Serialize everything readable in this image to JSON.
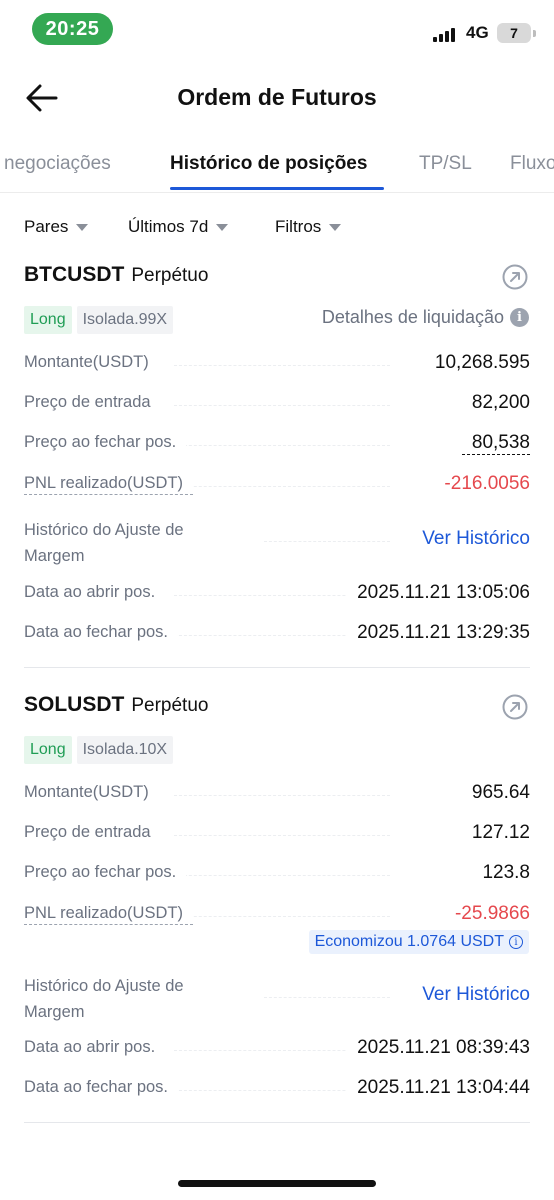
{
  "status_bar": {
    "time": "20:25",
    "network": "4G",
    "battery": "7"
  },
  "header": {
    "title": "Ordem de Futuros",
    "back_icon": "arrow-left-icon"
  },
  "tabs": [
    {
      "label": "negociações",
      "active": false
    },
    {
      "label": "Histórico de posições",
      "active": true
    },
    {
      "label": "TP/SL",
      "active": false
    },
    {
      "label": "Fluxo",
      "active": false
    }
  ],
  "filters": {
    "pairs": "Pares",
    "period": "Últimos 7d",
    "filters": "Filtros"
  },
  "colors": {
    "accent": "#1d58d8",
    "long_bg": "#e6f6ec",
    "long_text": "#1f9d55",
    "negative": "#e5484d",
    "status_green": "#34a853"
  },
  "positions": [
    {
      "symbol": "BTCUSDT",
      "contract_type": "Perpétuo",
      "side": "Long",
      "margin_mode": "Isolada.99X",
      "liquidation_details": "Detalhes de liquidação",
      "rows": {
        "amount": {
          "label": "Montante(USDT)",
          "value": "10,268.595"
        },
        "entry_price": {
          "label": "Preço de entrada",
          "value": "82,200"
        },
        "close_price": {
          "label": "Preço ao fechar pos.",
          "value": "80,538"
        },
        "pnl": {
          "label": "PNL realizado(USDT)",
          "value": "-216.0056"
        },
        "margin_history": {
          "label": "Histórico do Ajuste de Margem",
          "value": "Ver Histórico"
        },
        "open_date": {
          "label": "Data ao abrir pos.",
          "value": "2025.11.21 13:05:06"
        },
        "close_date": {
          "label": "Data ao fechar pos.",
          "value": "2025.11.21 13:29:35"
        }
      }
    },
    {
      "symbol": "SOLUSDT",
      "contract_type": "Perpétuo",
      "side": "Long",
      "margin_mode": "Isolada.10X",
      "saved_badge": "Economizou 1.0764 USDT",
      "rows": {
        "amount": {
          "label": "Montante(USDT)",
          "value": "965.64"
        },
        "entry_price": {
          "label": "Preço de entrada",
          "value": "127.12"
        },
        "close_price": {
          "label": "Preço ao fechar pos.",
          "value": "123.8"
        },
        "pnl": {
          "label": "PNL realizado(USDT)",
          "value": "-25.9866"
        },
        "margin_history": {
          "label": "Histórico do Ajuste de Margem",
          "value": "Ver Histórico"
        },
        "open_date": {
          "label": "Data ao abrir pos.",
          "value": "2025.11.21 08:39:43"
        },
        "close_date": {
          "label": "Data ao fechar pos.",
          "value": "2025.11.21 13:04:44"
        }
      }
    }
  ]
}
